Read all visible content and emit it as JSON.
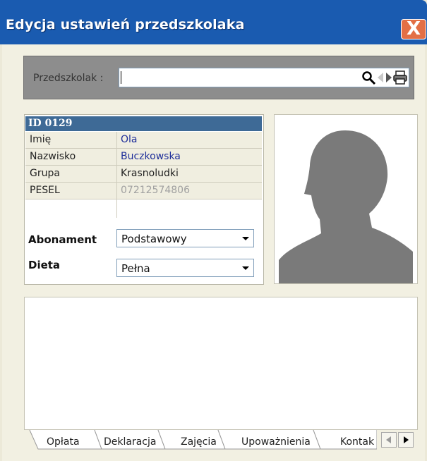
{
  "window": {
    "title": "Edycja ustawień przedszkolaka",
    "close_label": "X"
  },
  "search": {
    "label": "Przedszkolak :",
    "value": ""
  },
  "info": {
    "id_header": "ID 0129",
    "rows": [
      {
        "label": "Imię",
        "value": "Ola"
      },
      {
        "label": "Nazwisko",
        "value": "Buczkowska"
      },
      {
        "label": "Grupa",
        "value": "Krasnoludki"
      },
      {
        "label": "PESEL",
        "value": "07212574806"
      }
    ],
    "abonament": {
      "label": "Abonament",
      "selected": "Podstawowy"
    },
    "dieta": {
      "label": "Dieta",
      "selected": "Pełna"
    }
  },
  "tabs": [
    "Opłata",
    "Deklaracja",
    "Zajęcia",
    "Upoważnienia",
    "Kontak"
  ],
  "colors": {
    "title_bar": "#1a5bb0",
    "id_header": "#3e6a96",
    "link_value": "#1f2f9a",
    "pesel_value": "#a0a0a0"
  },
  "icons": [
    "search-icon",
    "prev-arrow-icon",
    "next-arrow-icon",
    "print-icon",
    "dropdown-arrow-icon",
    "tab-scroll-left-icon",
    "tab-scroll-right-icon"
  ]
}
